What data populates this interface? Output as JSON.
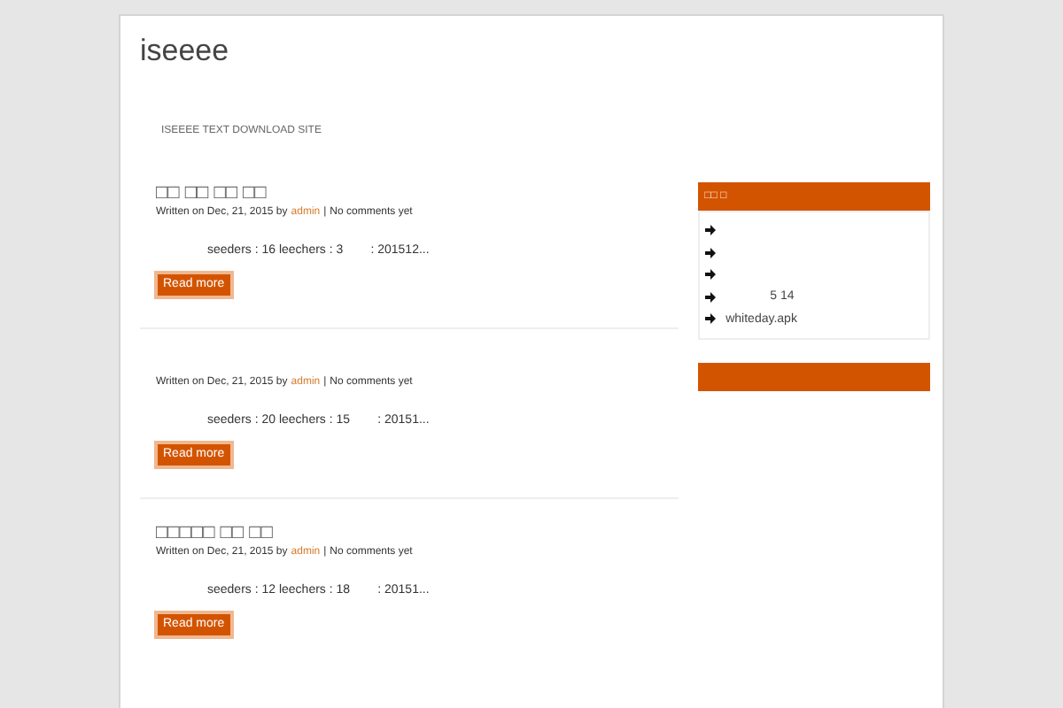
{
  "site": {
    "title": "iseeee",
    "tagline": "ISEEEE TEXT DOWNLOAD SITE"
  },
  "posts": [
    {
      "title": "□□ □□ □□ □□",
      "meta_prefix": "Written on Dec, 21, 2015 by",
      "author": "admin",
      "separator": "|",
      "comments": "No comments yet",
      "excerpt": "seeders : 16 leechers : 3        : 201512...",
      "button": "Read more"
    },
    {
      "meta_prefix": "Written on Dec, 21, 2015 by",
      "author": "admin",
      "separator": "|",
      "comments": "No comments yet",
      "excerpt": "seeders : 20 leechers : 15        : 20151...",
      "button": "Read more"
    },
    {
      "title": "□□□□□ □□ □□",
      "meta_prefix": "Written on Dec, 21, 2015 by",
      "author": "admin",
      "separator": "|",
      "comments": "No comments yet",
      "excerpt": "seeders : 12 leechers : 18        : 20151...",
      "button": "Read more"
    }
  ],
  "sidebar": {
    "widget_title": "□□ □",
    "items": [
      {
        "kind": "blank"
      },
      {
        "kind": "blank"
      },
      {
        "kind": "blank"
      },
      {
        "kind": "link",
        "text": "5 14"
      },
      {
        "kind": "link",
        "text": "whiteday.apk"
      }
    ]
  }
}
